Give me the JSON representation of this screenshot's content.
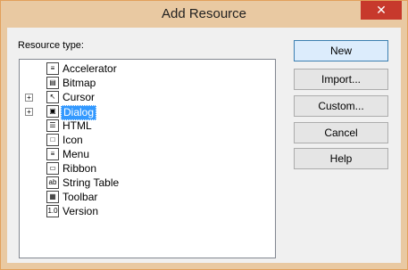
{
  "window": {
    "title": "Add Resource",
    "close_label": "✕"
  },
  "tree_label": "Resource type:",
  "tree_items": [
    {
      "label": "Accelerator",
      "icon": "accelerator-icon",
      "glyph": "≡",
      "expandable": false,
      "selected": false
    },
    {
      "label": "Bitmap",
      "icon": "bitmap-icon",
      "glyph": "▤",
      "expandable": false,
      "selected": false
    },
    {
      "label": "Cursor",
      "icon": "cursor-icon",
      "glyph": "↖",
      "expandable": true,
      "selected": false
    },
    {
      "label": "Dialog",
      "icon": "dialog-icon",
      "glyph": "▣",
      "expandable": true,
      "selected": true
    },
    {
      "label": "HTML",
      "icon": "html-icon",
      "glyph": "☰",
      "expandable": false,
      "selected": false
    },
    {
      "label": "Icon",
      "icon": "icon-resource-icon",
      "glyph": "□",
      "expandable": false,
      "selected": false
    },
    {
      "label": "Menu",
      "icon": "menu-icon",
      "glyph": "≡",
      "expandable": false,
      "selected": false
    },
    {
      "label": "Ribbon",
      "icon": "ribbon-icon",
      "glyph": "▭",
      "expandable": false,
      "selected": false
    },
    {
      "label": "String Table",
      "icon": "string-table-icon",
      "glyph": "ab",
      "expandable": false,
      "selected": false
    },
    {
      "label": "Toolbar",
      "icon": "toolbar-icon",
      "glyph": "▦",
      "expandable": false,
      "selected": false
    },
    {
      "label": "Version",
      "icon": "version-icon",
      "glyph": "1.0",
      "expandable": false,
      "selected": false
    }
  ],
  "buttons": {
    "new": "New",
    "import": "Import...",
    "custom": "Custom...",
    "cancel": "Cancel",
    "help": "Help"
  }
}
